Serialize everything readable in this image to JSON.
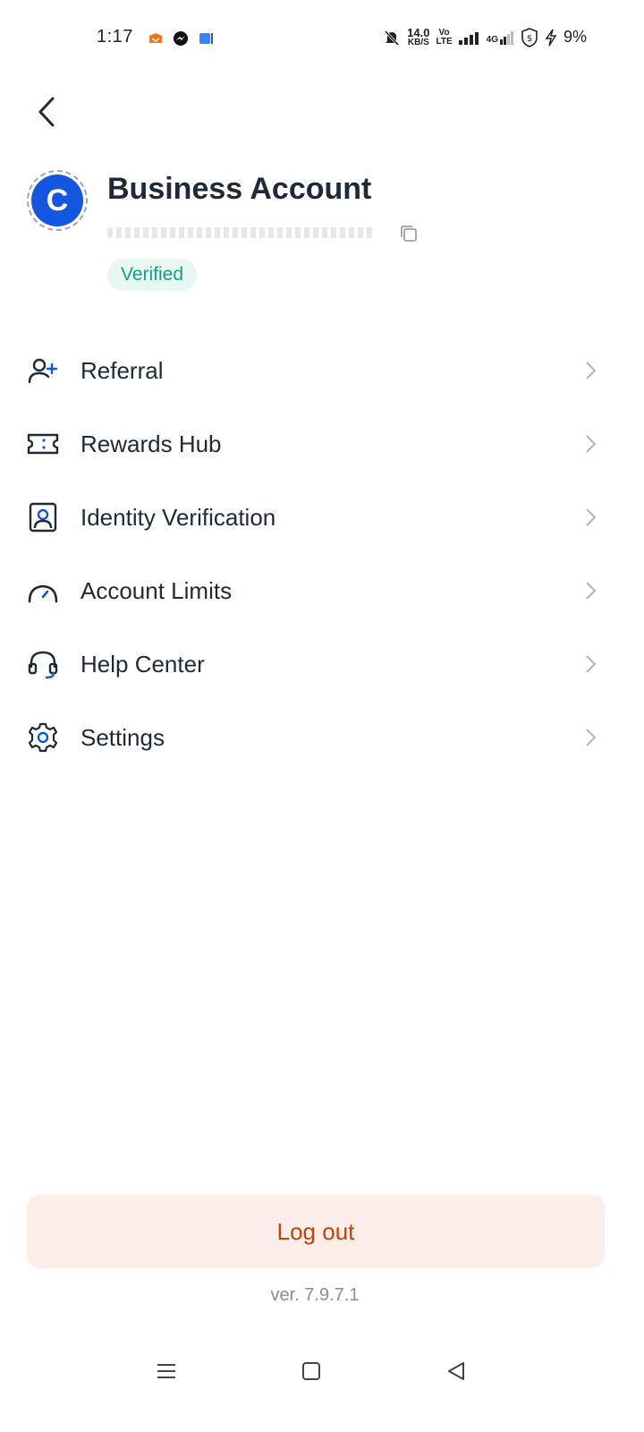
{
  "status_bar": {
    "time": "1:17",
    "net_speed_value": "14.0",
    "net_speed_unit": "KB/S",
    "volte_top": "Vo",
    "volte_bottom": "LTE",
    "signal_label": "4G",
    "battery": "9%"
  },
  "header": {
    "back_icon": "chevron-left-icon"
  },
  "profile": {
    "avatar_letter": "C",
    "avatar_color": "#1456e0",
    "name": "Business Account",
    "status": "Verified",
    "status_color": "#16a085"
  },
  "menu": {
    "items": [
      {
        "label": "Referral",
        "icon": "add-user-icon"
      },
      {
        "label": "Rewards Hub",
        "icon": "ticket-icon"
      },
      {
        "label": "Identity Verification",
        "icon": "id-badge-icon"
      },
      {
        "label": "Account Limits",
        "icon": "gauge-icon"
      },
      {
        "label": "Help Center",
        "icon": "headset-icon"
      },
      {
        "label": "Settings",
        "icon": "gear-icon"
      }
    ]
  },
  "footer": {
    "logout_label": "Log out",
    "logout_color": "#c2410c",
    "version": "ver. 7.9.7.1"
  },
  "colors": {
    "accent": "#1456e0",
    "text": "#1f2937"
  }
}
